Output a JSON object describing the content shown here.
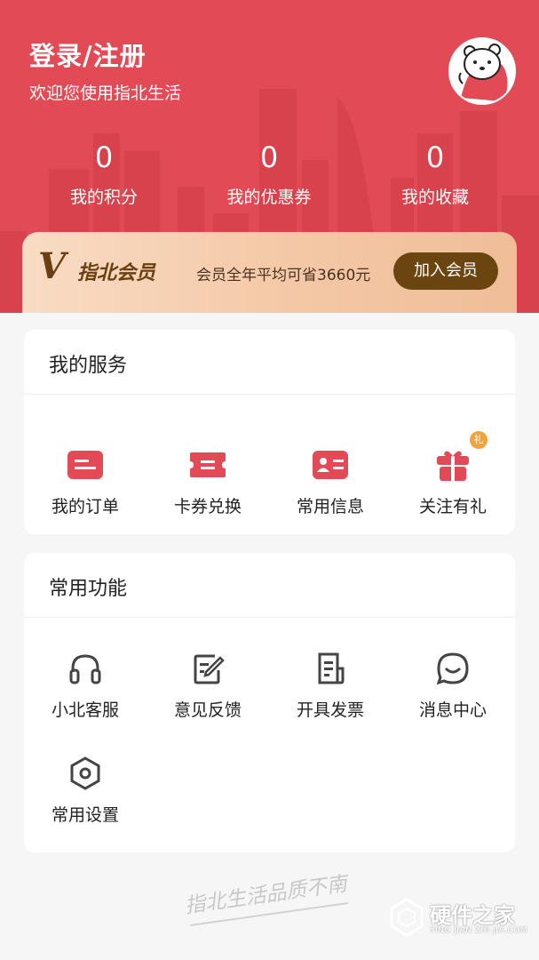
{
  "header": {
    "login_label": "登录/注册",
    "welcome": "欢迎您使用指北生活",
    "bg_color": "#e24b55"
  },
  "stats": [
    {
      "value": "0",
      "label": "我的积分"
    },
    {
      "value": "0",
      "label": "我的优惠券"
    },
    {
      "value": "0",
      "label": "我的收藏"
    }
  ],
  "vip": {
    "logo_letter": "V",
    "name": "指北会员",
    "description": "会员全年平均可省3660元",
    "join_label": "加入会员"
  },
  "services": {
    "title": "我的服务",
    "items": [
      {
        "label": "我的订单",
        "icon": "order-icon"
      },
      {
        "label": "卡券兑换",
        "icon": "ticket-icon"
      },
      {
        "label": "常用信息",
        "icon": "id-card-icon"
      },
      {
        "label": "关注有礼",
        "icon": "gift-icon",
        "badge": "礼"
      }
    ]
  },
  "functions": {
    "title": "常用功能",
    "items": [
      {
        "label": "小北客服",
        "icon": "headset-icon"
      },
      {
        "label": "意见反馈",
        "icon": "feedback-icon"
      },
      {
        "label": "开具发票",
        "icon": "invoice-icon"
      },
      {
        "label": "消息中心",
        "icon": "message-icon"
      },
      {
        "label": "常用设置",
        "icon": "settings-icon"
      }
    ]
  },
  "footer": {
    "slogan": "指北生活品质不南",
    "watermark": "硬件之家",
    "watermark_sub": "YING JIAN ZHI JIA.COM"
  },
  "colors": {
    "accent": "#e24b55",
    "vip_button": "#6b4510",
    "badge": "#f0a43b"
  }
}
